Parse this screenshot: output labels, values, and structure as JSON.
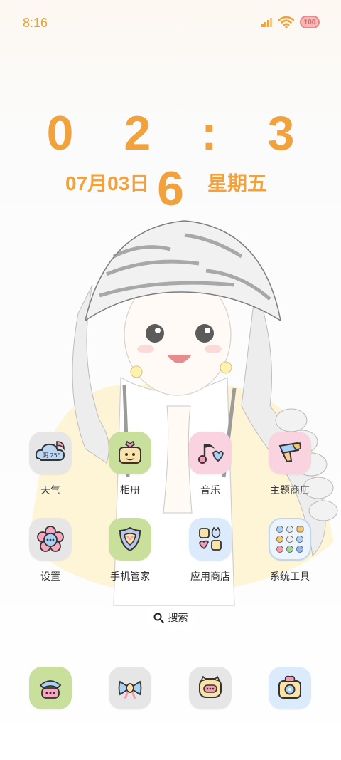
{
  "status": {
    "time": "8:16",
    "battery": "100"
  },
  "clock": {
    "time": "0 2 : 3 6",
    "date": "07月03日",
    "weekday": "星期五"
  },
  "apps": [
    {
      "label": "天气",
      "icon": "weather-cloud-icon",
      "badge": "阴 25°"
    },
    {
      "label": "相册",
      "icon": "photo-album-icon"
    },
    {
      "label": "音乐",
      "icon": "music-note-icon"
    },
    {
      "label": "主题商店",
      "icon": "paint-brush-icon"
    },
    {
      "label": "设置",
      "icon": "settings-flower-icon"
    },
    {
      "label": "手机管家",
      "icon": "shield-icon"
    },
    {
      "label": "应用商店",
      "icon": "app-store-icon"
    },
    {
      "label": "系统工具",
      "icon": "system-tools-folder-icon"
    }
  ],
  "search": {
    "label": "搜索"
  },
  "dock": [
    {
      "icon": "phone-icon"
    },
    {
      "icon": "messages-bow-icon"
    },
    {
      "icon": "contacts-piggy-icon"
    },
    {
      "icon": "camera-icon"
    }
  ],
  "colors": {
    "accent": "#f2a23c",
    "status": "#e8a23a"
  }
}
